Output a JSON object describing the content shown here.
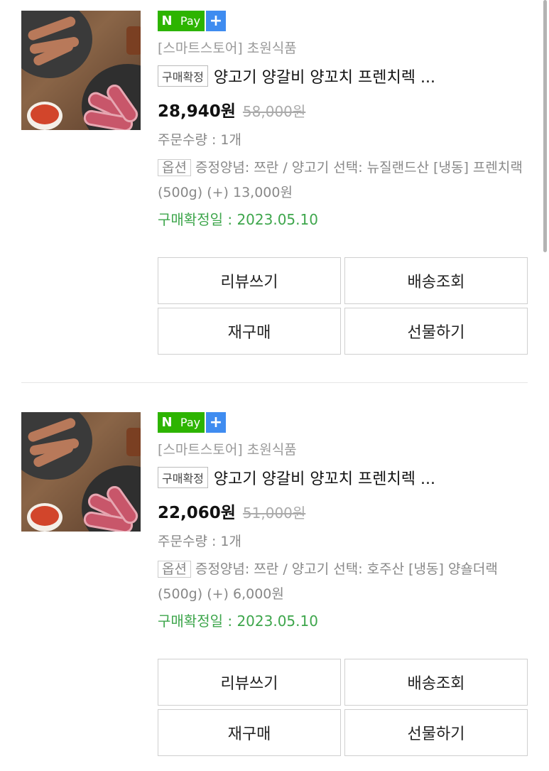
{
  "orders": [
    {
      "npay": {
        "n": "N",
        "pay": "Pay",
        "plus": "+"
      },
      "store": "[스마트스토어] 초원식품",
      "badge": "구매확정",
      "title": "양고기 양갈비 양꼬치 프렌치렉 ...",
      "price": "28,940원",
      "original_price": "58,000원",
      "quantity": "주문수량 : 1개",
      "option_tag": "옵션",
      "option_text": "증정양념: 쯔란 / 양고기 선택: 뉴질랜드산 [냉동] 프렌치랙(500g) (+) 13,000원",
      "confirm_date": "구매확정일 : 2023.05.10",
      "buttons": {
        "review": "리뷰쓰기",
        "delivery": "배송조회",
        "rebuy": "재구매",
        "gift": "선물하기"
      }
    },
    {
      "npay": {
        "n": "N",
        "pay": "Pay",
        "plus": "+"
      },
      "store": "[스마트스토어] 초원식품",
      "badge": "구매확정",
      "title": "양고기 양갈비 양꼬치 프렌치렉 ...",
      "price": "22,060원",
      "original_price": "51,000원",
      "quantity": "주문수량 : 1개",
      "option_tag": "옵션",
      "option_text": "증정양념: 쯔란 / 양고기 선택: 호주산 [냉동] 양숄더랙 (500g) (+) 6,000원",
      "confirm_date": "구매확정일 : 2023.05.10",
      "buttons": {
        "review": "리뷰쓰기",
        "delivery": "배송조회",
        "rebuy": "재구매",
        "gift": "선물하기"
      }
    }
  ],
  "colors": {
    "npay_green": "#2db400",
    "npay_plus_blue": "#3f8cf0",
    "confirm_green": "#3ea64c"
  }
}
